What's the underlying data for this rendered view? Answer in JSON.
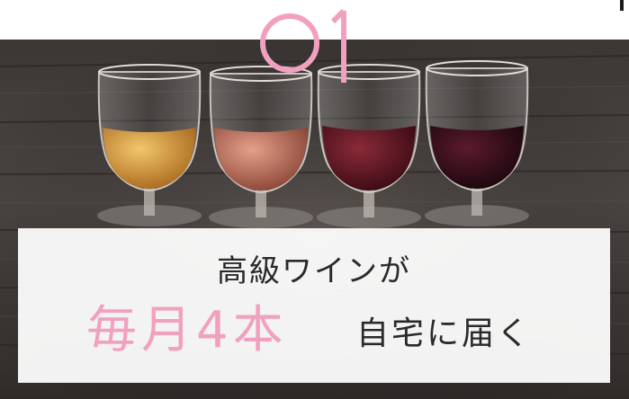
{
  "step": {
    "number": "01",
    "color": "#f2a0bf"
  },
  "caption": {
    "line1": "高級ワインが",
    "highlight": "毎月4本",
    "rest": "自宅に届く",
    "highlight_color": "#f2a0bf",
    "text_color": "#2a2a2a"
  },
  "photo": {
    "subject": "wine-glasses-on-barrel",
    "glass_colors": [
      "#d99a35",
      "#c97862",
      "#5a1522",
      "#2e0d18"
    ]
  }
}
